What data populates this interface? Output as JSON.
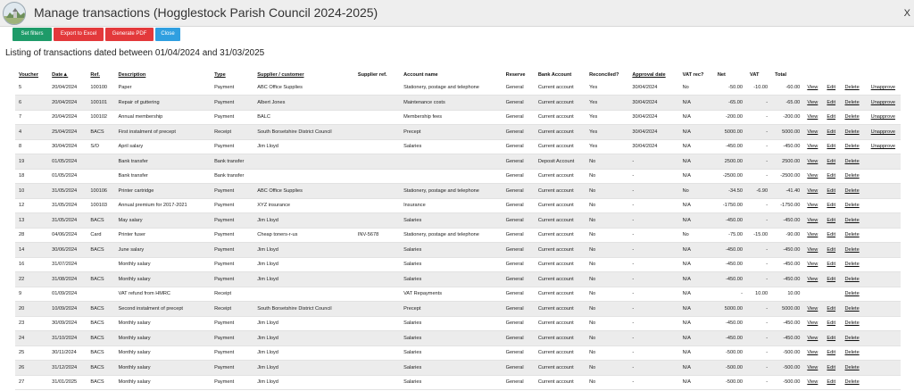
{
  "window": {
    "title": "Manage transactions (Hogglestock Parish Council 2024-2025)",
    "close_label": "X",
    "logo_text": "Parish Council"
  },
  "toolbar": {
    "set_filters": "Set filters",
    "export_excel": "Export to Excel",
    "generate_pdf": "Generate PDF",
    "close": "Close"
  },
  "listing_caption": "Listing of transactions dated between 01/04/2024 and 31/03/2025",
  "colors": {
    "green": "#1e9b69",
    "red": "#e3393b",
    "blue": "#2f9fe0"
  },
  "table": {
    "headers": {
      "voucher": "Voucher",
      "date": "Date",
      "date_sort": "▲",
      "ref": "Ref.",
      "description": "Description",
      "type": "Type",
      "supplier": "Supplier / customer",
      "supplier_ref": "Supplier ref.",
      "account": "Account name",
      "reserve": "Reserve",
      "bank": "Bank Account",
      "reconciled": "Reconciled?",
      "approval": "Approval date",
      "vat_rec": "VAT rec?",
      "net": "Net",
      "vat": "VAT",
      "total": "Total"
    },
    "action_labels": {
      "view": "View",
      "edit": "Edit",
      "delete": "Delete",
      "unapprove": "Unapprove"
    },
    "rows": [
      {
        "voucher": "5",
        "date": "20/04/2024",
        "ref": "100100",
        "description": "Paper",
        "type": "Payment",
        "supplier": "ABC Office Supplies",
        "supplier_ref": "",
        "account": "Stationery, postage and telephone",
        "reserve": "General",
        "bank": "Current account",
        "reconciled": "Yes",
        "approval": "30/04/2024",
        "vat_rec": "No",
        "net": "-50.00",
        "vat": "-10.00",
        "total": "-60.00",
        "actions": [
          "View",
          "Edit",
          "Delete",
          "Unapprove"
        ]
      },
      {
        "voucher": "6",
        "date": "20/04/2024",
        "ref": "100101",
        "description": "Repair of guttering",
        "type": "Payment",
        "supplier": "Albert Jones",
        "supplier_ref": "",
        "account": "Maintenance costs",
        "reserve": "General",
        "bank": "Current account",
        "reconciled": "Yes",
        "approval": "30/04/2024",
        "vat_rec": "N/A",
        "net": "-65.00",
        "vat": "-",
        "total": "-65.00",
        "actions": [
          "View",
          "Edit",
          "Delete",
          "Unapprove"
        ]
      },
      {
        "voucher": "7",
        "date": "20/04/2024",
        "ref": "100102",
        "description": "Annual membership",
        "type": "Payment",
        "supplier": "BALC",
        "supplier_ref": "",
        "account": "Membership fees",
        "reserve": "General",
        "bank": "Current account",
        "reconciled": "Yes",
        "approval": "30/04/2024",
        "vat_rec": "N/A",
        "net": "-200.00",
        "vat": "-",
        "total": "-200.00",
        "actions": [
          "View",
          "Edit",
          "Delete",
          "Unapprove"
        ]
      },
      {
        "voucher": "4",
        "date": "25/04/2024",
        "ref": "BACS",
        "description": "First instalment of precept",
        "type": "Receipt",
        "supplier": "South Borsetshire District Council",
        "supplier_ref": "",
        "account": "Precept",
        "reserve": "General",
        "bank": "Current account",
        "reconciled": "Yes",
        "approval": "30/04/2024",
        "vat_rec": "N/A",
        "net": "5000.00",
        "vat": "-",
        "total": "5000.00",
        "actions": [
          "View",
          "Edit",
          "Delete",
          "Unapprove"
        ]
      },
      {
        "voucher": "8",
        "date": "30/04/2024",
        "ref": "S/O",
        "description": "April salary",
        "type": "Payment",
        "supplier": "Jim Lloyd",
        "supplier_ref": "",
        "account": "Salaries",
        "reserve": "General",
        "bank": "Current account",
        "reconciled": "Yes",
        "approval": "30/04/2024",
        "vat_rec": "N/A",
        "net": "-450.00",
        "vat": "-",
        "total": "-450.00",
        "actions": [
          "View",
          "Edit",
          "Delete",
          "Unapprove"
        ]
      },
      {
        "voucher": "19",
        "date": "01/05/2024",
        "ref": "",
        "description": "Bank transfer",
        "type": "Bank transfer",
        "supplier": "",
        "supplier_ref": "",
        "account": "",
        "reserve": "General",
        "bank": "Deposit Account",
        "reconciled": "No",
        "approval": "-",
        "vat_rec": "N/A",
        "net": "2500.00",
        "vat": "-",
        "total": "2500.00",
        "actions": [
          "View",
          "Edit",
          "Delete"
        ]
      },
      {
        "voucher": "18",
        "date": "01/05/2024",
        "ref": "",
        "description": "Bank transfer",
        "type": "Bank transfer",
        "supplier": "",
        "supplier_ref": "",
        "account": "",
        "reserve": "General",
        "bank": "Current account",
        "reconciled": "No",
        "approval": "-",
        "vat_rec": "N/A",
        "net": "-2500.00",
        "vat": "-",
        "total": "-2500.00",
        "actions": [
          "View",
          "Edit",
          "Delete"
        ]
      },
      {
        "voucher": "10",
        "date": "31/05/2024",
        "ref": "100106",
        "description": "Printer cartridge",
        "type": "Payment",
        "supplier": "ABC Office Supplies",
        "supplier_ref": "",
        "account": "Stationery, postage and telephone",
        "reserve": "General",
        "bank": "Current account",
        "reconciled": "No",
        "approval": "-",
        "vat_rec": "No",
        "net": "-34.50",
        "vat": "-6.90",
        "total": "-41.40",
        "actions": [
          "View",
          "Edit",
          "Delete"
        ]
      },
      {
        "voucher": "12",
        "date": "31/05/2024",
        "ref": "100103",
        "description": "Annual premium for 2017-2021",
        "type": "Payment",
        "supplier": "XYZ insurance",
        "supplier_ref": "",
        "account": "Insurance",
        "reserve": "General",
        "bank": "Current account",
        "reconciled": "No",
        "approval": "-",
        "vat_rec": "N/A",
        "net": "-1750.00",
        "vat": "-",
        "total": "-1750.00",
        "actions": [
          "View",
          "Edit",
          "Delete"
        ]
      },
      {
        "voucher": "13",
        "date": "31/05/2024",
        "ref": "BACS",
        "description": "May salary",
        "type": "Payment",
        "supplier": "Jim Lloyd",
        "supplier_ref": "",
        "account": "Salaries",
        "reserve": "General",
        "bank": "Current account",
        "reconciled": "No",
        "approval": "-",
        "vat_rec": "N/A",
        "net": "-450.00",
        "vat": "-",
        "total": "-450.00",
        "actions": [
          "View",
          "Edit",
          "Delete"
        ]
      },
      {
        "voucher": "28",
        "date": "04/06/2024",
        "ref": "Card",
        "description": "Printer fuser",
        "type": "Payment",
        "supplier": "Cheap toners-r-us",
        "supplier_ref": "INV-5678",
        "account": "Stationery, postage and telephone",
        "reserve": "General",
        "bank": "Current account",
        "reconciled": "No",
        "approval": "-",
        "vat_rec": "No",
        "net": "-75.00",
        "vat": "-15.00",
        "total": "-90.00",
        "actions": [
          "View",
          "Edit",
          "Delete"
        ]
      },
      {
        "voucher": "14",
        "date": "30/06/2024",
        "ref": "BACS",
        "description": "June salary",
        "type": "Payment",
        "supplier": "Jim Lloyd",
        "supplier_ref": "",
        "account": "Salaries",
        "reserve": "General",
        "bank": "Current account",
        "reconciled": "No",
        "approval": "-",
        "vat_rec": "N/A",
        "net": "-450.00",
        "vat": "-",
        "total": "-450.00",
        "actions": [
          "View",
          "Edit",
          "Delete"
        ]
      },
      {
        "voucher": "16",
        "date": "31/07/2024",
        "ref": "",
        "description": "Monthly salary",
        "type": "Payment",
        "supplier": "Jim Lloyd",
        "supplier_ref": "",
        "account": "Salaries",
        "reserve": "General",
        "bank": "Current account",
        "reconciled": "No",
        "approval": "-",
        "vat_rec": "N/A",
        "net": "-450.00",
        "vat": "-",
        "total": "-450.00",
        "actions": [
          "View",
          "Edit",
          "Delete"
        ]
      },
      {
        "voucher": "22",
        "date": "31/08/2024",
        "ref": "BACS",
        "description": "Monthly salary",
        "type": "Payment",
        "supplier": "Jim Lloyd",
        "supplier_ref": "",
        "account": "Salaries",
        "reserve": "General",
        "bank": "Current account",
        "reconciled": "No",
        "approval": "-",
        "vat_rec": "N/A",
        "net": "-450.00",
        "vat": "-",
        "total": "-450.00",
        "actions": [
          "View",
          "Edit",
          "Delete"
        ]
      },
      {
        "voucher": "9",
        "date": "01/09/2024",
        "ref": "",
        "description": "VAT refund from HMRC",
        "type": "Receipt",
        "supplier": "",
        "supplier_ref": "",
        "account": "VAT Repayments",
        "reserve": "General",
        "bank": "Current account",
        "reconciled": "No",
        "approval": "-",
        "vat_rec": "N/A",
        "net": "-",
        "vat": "10.00",
        "total": "10.00",
        "actions": [
          "",
          "",
          "Delete"
        ]
      },
      {
        "voucher": "20",
        "date": "10/09/2024",
        "ref": "BACS",
        "description": "Second instalment of precept",
        "type": "Receipt",
        "supplier": "South Borsetshire District Council",
        "supplier_ref": "",
        "account": "Precept",
        "reserve": "General",
        "bank": "Current account",
        "reconciled": "No",
        "approval": "-",
        "vat_rec": "N/A",
        "net": "5000.00",
        "vat": "-",
        "total": "5000.00",
        "actions": [
          "View",
          "Edit",
          "Delete"
        ]
      },
      {
        "voucher": "23",
        "date": "30/09/2024",
        "ref": "BACS",
        "description": "Monthly salary",
        "type": "Payment",
        "supplier": "Jim Lloyd",
        "supplier_ref": "",
        "account": "Salaries",
        "reserve": "General",
        "bank": "Current account",
        "reconciled": "No",
        "approval": "-",
        "vat_rec": "N/A",
        "net": "-450.00",
        "vat": "-",
        "total": "-450.00",
        "actions": [
          "View",
          "Edit",
          "Delete"
        ]
      },
      {
        "voucher": "24",
        "date": "31/10/2024",
        "ref": "BACS",
        "description": "Monthly salary",
        "type": "Payment",
        "supplier": "Jim Lloyd",
        "supplier_ref": "",
        "account": "Salaries",
        "reserve": "General",
        "bank": "Current account",
        "reconciled": "No",
        "approval": "-",
        "vat_rec": "N/A",
        "net": "-450.00",
        "vat": "-",
        "total": "-450.00",
        "actions": [
          "View",
          "Edit",
          "Delete"
        ]
      },
      {
        "voucher": "25",
        "date": "30/11/2024",
        "ref": "BACS",
        "description": "Monthly salary",
        "type": "Payment",
        "supplier": "Jim Lloyd",
        "supplier_ref": "",
        "account": "Salaries",
        "reserve": "General",
        "bank": "Current account",
        "reconciled": "No",
        "approval": "-",
        "vat_rec": "N/A",
        "net": "-500.00",
        "vat": "-",
        "total": "-500.00",
        "actions": [
          "View",
          "Edit",
          "Delete"
        ]
      },
      {
        "voucher": "26",
        "date": "31/12/2024",
        "ref": "BACS",
        "description": "Monthly salary",
        "type": "Payment",
        "supplier": "Jim Lloyd",
        "supplier_ref": "",
        "account": "Salaries",
        "reserve": "General",
        "bank": "Current account",
        "reconciled": "No",
        "approval": "-",
        "vat_rec": "N/A",
        "net": "-500.00",
        "vat": "-",
        "total": "-500.00",
        "actions": [
          "View",
          "Edit",
          "Delete"
        ]
      },
      {
        "voucher": "27",
        "date": "31/01/2025",
        "ref": "BACS",
        "description": "Monthly salary",
        "type": "Payment",
        "supplier": "Jim Lloyd",
        "supplier_ref": "",
        "account": "Salaries",
        "reserve": "General",
        "bank": "Current account",
        "reconciled": "No",
        "approval": "-",
        "vat_rec": "N/A",
        "net": "-500.00",
        "vat": "-",
        "total": "-500.00",
        "actions": [
          "View",
          "Edit",
          "Delete"
        ]
      }
    ]
  }
}
